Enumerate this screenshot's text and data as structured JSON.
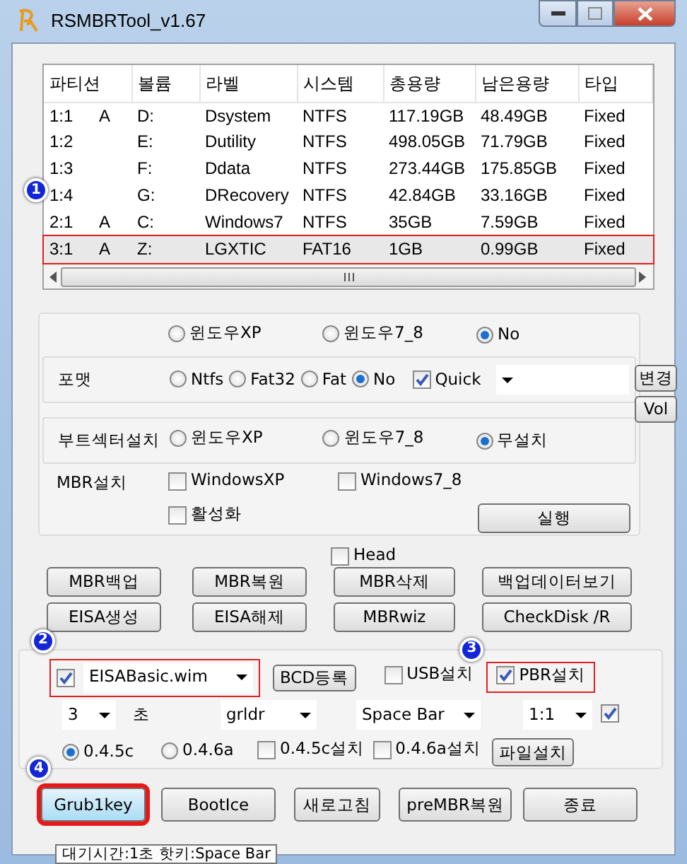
{
  "window": {
    "title": "RSMBRTool_v1.67"
  },
  "partitions": {
    "columns": [
      "파티션",
      "볼륨",
      "라벨",
      "시스템",
      "총용량",
      "남은용량",
      "타입"
    ],
    "rows": [
      {
        "partition": "1:1",
        "active": "A",
        "volume": "D:",
        "label": "Dsystem",
        "system": "NTFS",
        "total": "117.19GB",
        "free": "48.49GB",
        "type": "Fixed",
        "selected": false
      },
      {
        "partition": "1:2",
        "volume": "E:",
        "label": "Dutility",
        "system": "NTFS",
        "total": "498.05GB",
        "free": "71.79GB",
        "type": "Fixed",
        "selected": false
      },
      {
        "partition": "1:3",
        "volume": "F:",
        "label": "Ddata",
        "system": "NTFS",
        "total": "273.44GB",
        "free": "175.85GB",
        "type": "Fixed",
        "selected": false
      },
      {
        "partition": "1:4",
        "volume": "G:",
        "label": "DRecovery",
        "system": "NTFS",
        "total": "42.84GB",
        "free": "33.16GB",
        "type": "Fixed",
        "selected": false,
        "callout": "1"
      },
      {
        "partition": "2:1",
        "active": "A",
        "volume": "C:",
        "label": "Windows7",
        "system": "NTFS",
        "total": "35GB",
        "free": "7.59GB",
        "type": "Fixed",
        "selected": false
      },
      {
        "partition": "3:1",
        "active": "A",
        "volume": "Z:",
        "label": "LGXTIC",
        "system": "FAT16",
        "total": "1GB",
        "free": "0.99GB",
        "type": "Fixed",
        "selected": true,
        "highlighted": true
      }
    ]
  },
  "os_options": [
    {
      "label": "윈도우XP",
      "selected": false
    },
    {
      "label": "윈도우7_8",
      "selected": false
    },
    {
      "label": "No",
      "selected": true
    }
  ],
  "format": {
    "label": "포맷",
    "options": [
      {
        "label": "Ntfs",
        "selected": false
      },
      {
        "label": "Fat32",
        "selected": false
      },
      {
        "label": "Fat",
        "selected": false
      },
      {
        "label": "No",
        "selected": true
      }
    ],
    "quick": {
      "label": "Quick",
      "checked": true
    },
    "change_button": "변경",
    "vol_button": "Vol"
  },
  "boot_sector": {
    "label": "부트섹터설치",
    "options": [
      {
        "label": "윈도우XP",
        "selected": false
      },
      {
        "label": "윈도우7_8",
        "selected": false
      },
      {
        "label": "무설치",
        "selected": true
      }
    ]
  },
  "mbr_install": {
    "label": "MBR설치",
    "options": [
      {
        "label": "WindowsXP",
        "checked": false
      },
      {
        "label": "Windows7_8",
        "checked": false
      },
      {
        "label": "활성화",
        "checked": false
      }
    ],
    "run_button": "실행"
  },
  "head": {
    "label": "Head",
    "checked": false
  },
  "mbr_buttons": [
    "MBR백업",
    "MBR복원",
    "MBR삭제",
    "백업데이터보기",
    "EISA생성",
    "EISA해제",
    "MBRwiz",
    "CheckDisk /R"
  ],
  "grub": {
    "eisa": {
      "checked": true,
      "value": "EISABasic.wim",
      "highlighted": true,
      "callout": "2"
    },
    "bcd_button": "BCD등록",
    "usb": {
      "label": "USB설치",
      "checked": false
    },
    "pbr": {
      "label": "PBR설치",
      "checked": true,
      "highlighted": true,
      "callout": "3"
    },
    "timeout": "3",
    "seconds_label": "초",
    "loader": "grldr",
    "hotkey": "Space Bar",
    "partition": "1:1",
    "partition_checked": true,
    "versions": [
      {
        "label": "0.4.5c",
        "selected": true
      },
      {
        "label": "0.4.6a",
        "selected": false
      }
    ],
    "installs": [
      {
        "label": "0.4.5c설치",
        "checked": false
      },
      {
        "label": "0.4.6a설치",
        "checked": false
      }
    ],
    "file_button": "파일설치"
  },
  "bottom_buttons": [
    {
      "label": "Grub1key",
      "highlighted": true,
      "callout": "4"
    },
    {
      "label": "BootIce",
      "highlighted": false
    },
    {
      "label": "새로고침",
      "highlighted": false
    },
    {
      "label": "preMBR복원",
      "highlighted": false
    },
    {
      "label": "종료",
      "highlighted": false
    }
  ],
  "tooltip": "대기시간:1초  핫키:Space Bar"
}
